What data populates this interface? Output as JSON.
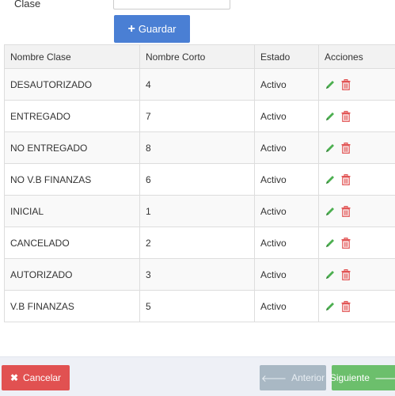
{
  "form": {
    "clase_label": "Clase",
    "clase_value": "",
    "guardar_label": "Guardar"
  },
  "table": {
    "headers": {
      "nombre_clase": "Nombre Clase",
      "nombre_corto": "Nombre Corto",
      "estado": "Estado",
      "acciones": "Acciones"
    },
    "rows": [
      {
        "nombre_clase": "DESAUTORIZADO",
        "nombre_corto": "4",
        "estado": "Activo"
      },
      {
        "nombre_clase": "ENTREGADO",
        "nombre_corto": "7",
        "estado": "Activo"
      },
      {
        "nombre_clase": "NO ENTREGADO",
        "nombre_corto": "8",
        "estado": "Activo"
      },
      {
        "nombre_clase": "NO V.B FINANZAS",
        "nombre_corto": "6",
        "estado": "Activo"
      },
      {
        "nombre_clase": "INICIAL",
        "nombre_corto": "1",
        "estado": "Activo"
      },
      {
        "nombre_clase": "CANCELADO",
        "nombre_corto": "2",
        "estado": "Activo"
      },
      {
        "nombre_clase": "AUTORIZADO",
        "nombre_corto": "3",
        "estado": "Activo"
      },
      {
        "nombre_clase": "V.B FINANZAS",
        "nombre_corto": "5",
        "estado": "Activo"
      }
    ],
    "row_actions": [
      "pencil-icon",
      "trash-icon"
    ]
  },
  "footer": {
    "cancel_label": "Cancelar",
    "prev_label": "Anterior",
    "next_label": "Siguiente"
  },
  "colors": {
    "primary": "#4a7fd4",
    "danger": "#e15151",
    "success": "#6cbf6c",
    "disabled": "#a9b8c4",
    "edit_icon": "#4caf50",
    "delete_icon": "#e15151"
  }
}
